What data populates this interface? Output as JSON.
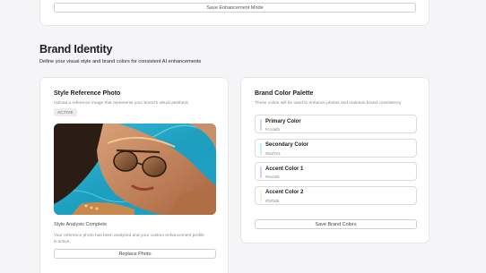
{
  "top": {
    "save_mode_label": "Save Enhancement Mode"
  },
  "section": {
    "title": "Brand Identity",
    "subtitle": "Define your visual style and brand colors for consistent AI enhancements"
  },
  "style_reference": {
    "title": "Style Reference Photo",
    "description": "Upload a reference image that represents your brand's visual aesthetic",
    "badge": "ACTIVE",
    "analysis_title": "Style Analysis Complete",
    "analysis_text": "Your reference photo has been analyzed and your custom enhancement profile is active.",
    "replace_label": "Replace Photo"
  },
  "palette": {
    "title": "Brand Color Palette",
    "description": "These colors will be used to enhance photos and maintain brand consistency",
    "colors": [
      {
        "name": "Primary Color",
        "hex": "#ccdaf5",
        "color": "#ccdaf5"
      },
      {
        "name": "Secondary Color",
        "hex": "#baf7e3",
        "color": "#baf7e3"
      },
      {
        "name": "Accent Color 1",
        "hex": "#eac5fc",
        "color": "#eac5fc"
      },
      {
        "name": "Accent Color 2",
        "hex": "#fcf0d8",
        "color": "#fcf0d8"
      }
    ],
    "save_label": "Save Brand Colors"
  }
}
